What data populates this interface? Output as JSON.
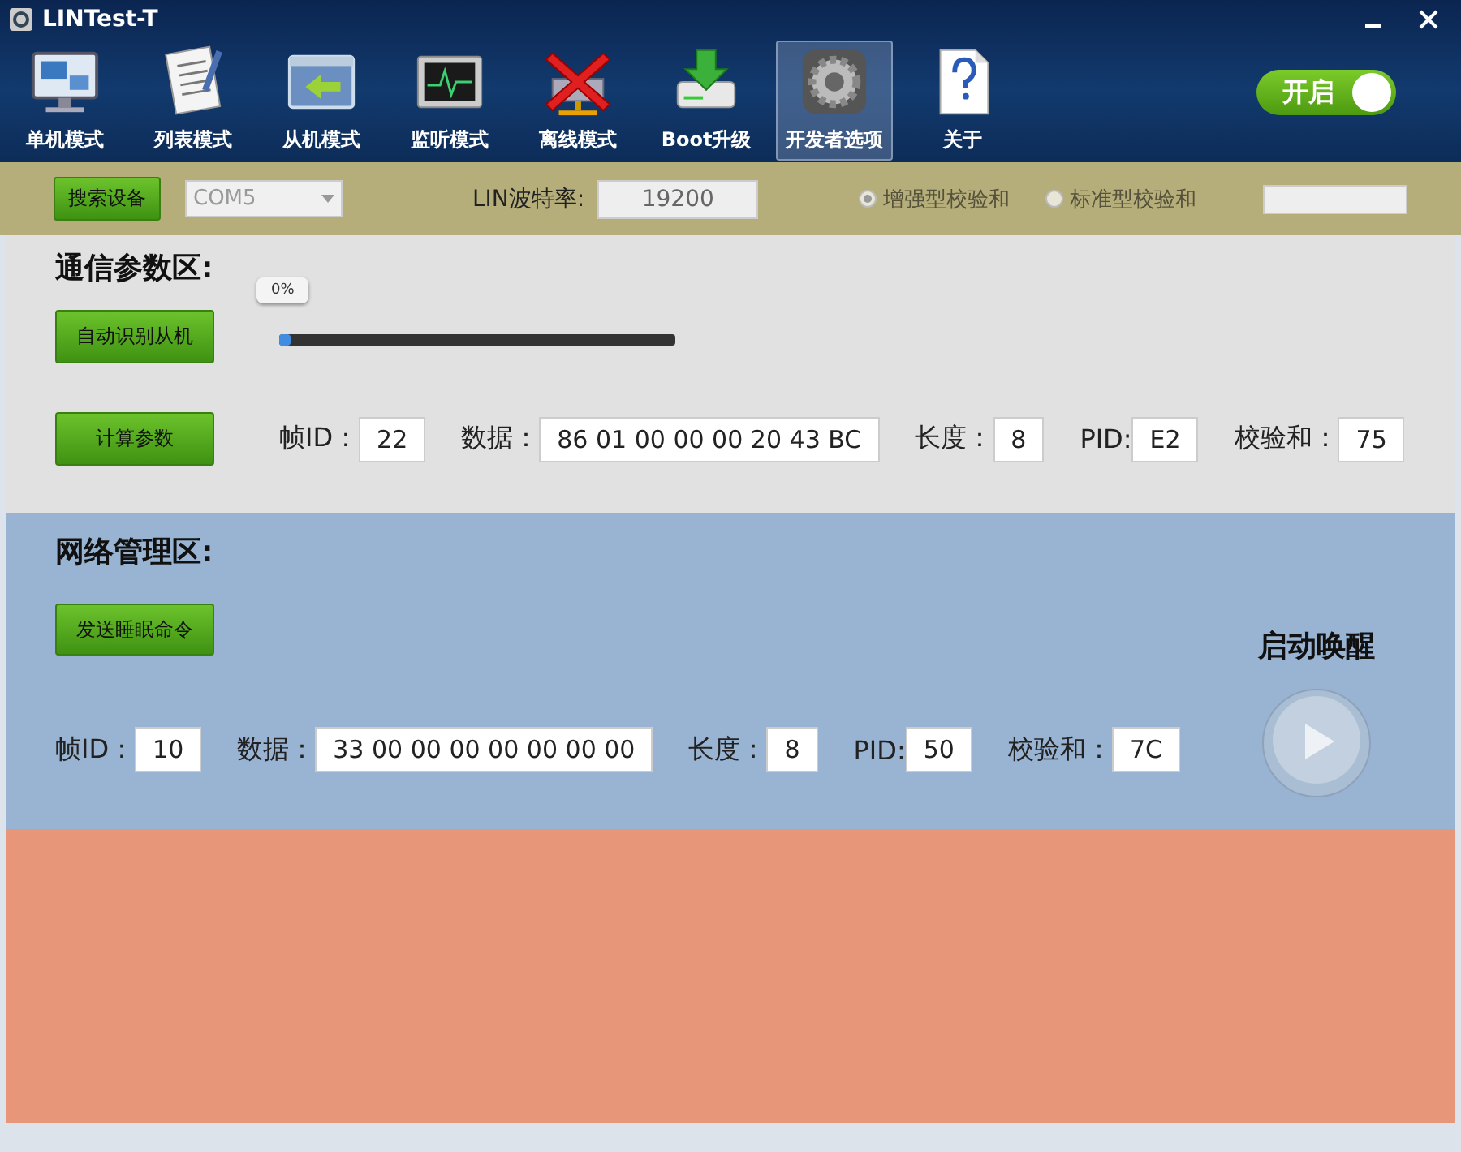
{
  "window": {
    "title": "LINTest-T"
  },
  "toolbar": [
    {
      "label": "单机模式",
      "selected": false
    },
    {
      "label": "列表模式",
      "selected": false
    },
    {
      "label": "从机模式",
      "selected": false
    },
    {
      "label": "监听模式",
      "selected": false
    },
    {
      "label": "离线模式",
      "selected": false
    },
    {
      "label": "Boot升级",
      "selected": false
    },
    {
      "label": "开发者选项",
      "selected": true
    },
    {
      "label": "关于",
      "selected": false
    }
  ],
  "power_switch": {
    "label": "开启",
    "on": true
  },
  "device_bar": {
    "search_button": "搜索设备",
    "port": "COM5",
    "baud_label": "LIN波特率:",
    "baud": "19200",
    "checksum_options": [
      {
        "label": "增强型校验和",
        "selected": true
      },
      {
        "label": "标准型校验和",
        "selected": false
      }
    ]
  },
  "comm_section": {
    "title": "通信参数区:",
    "detect_button": "自动识别从机",
    "progress": {
      "label": "0%",
      "level": 0.03
    },
    "calc_button": "计算参数",
    "fields": [
      {
        "label": "帧ID：",
        "value": "22"
      },
      {
        "label": "数据：",
        "value": "86 01 00 00 00 20 43 BC"
      },
      {
        "label": "长度：",
        "value": "8"
      },
      {
        "label": "PID:",
        "value": "E2"
      },
      {
        "label": "校验和：",
        "value": "75"
      }
    ]
  },
  "network_section": {
    "title": "网络管理区:",
    "sleep_button": "发送睡眠命令",
    "wake_label": "启动唤醒",
    "fields": [
      {
        "label": "帧ID：",
        "value": "10"
      },
      {
        "label": "数据：",
        "value": "33 00 00 00 00 00 00 00"
      },
      {
        "label": "长度：",
        "value": "8"
      },
      {
        "label": "PID:",
        "value": "50"
      },
      {
        "label": "校验和：",
        "value": "7C"
      }
    ]
  }
}
